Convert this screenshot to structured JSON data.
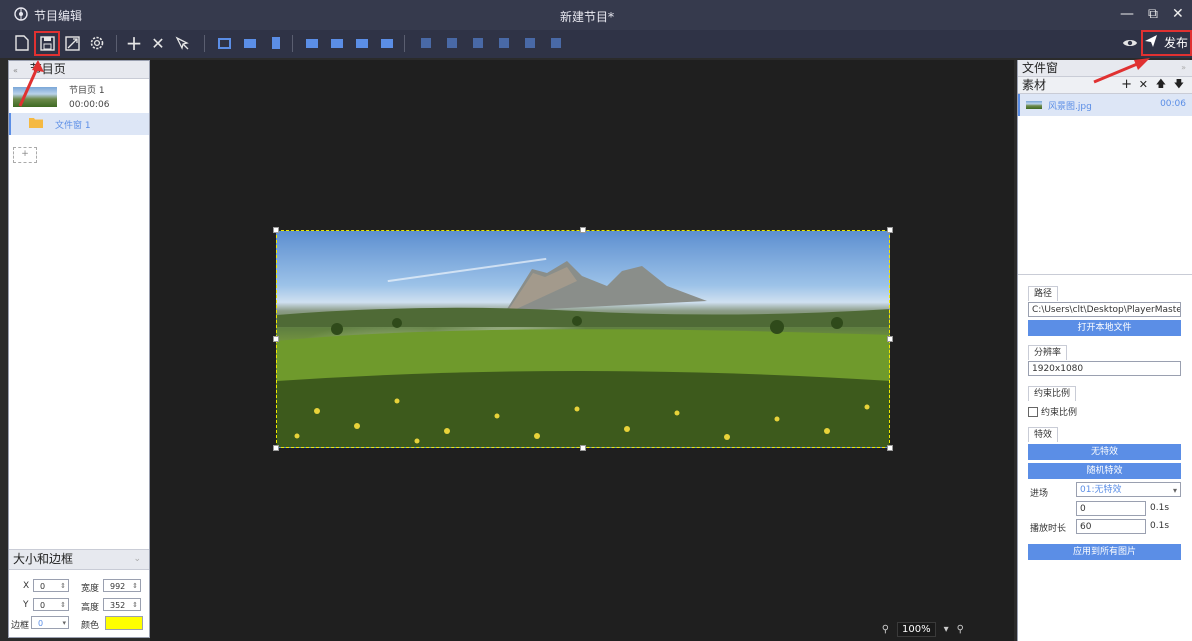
{
  "titlebar": {
    "app_title": "节目编辑",
    "document_title": "新建节目*",
    "restore_icon": "restore-icon",
    "close_icon": "close-icon"
  },
  "toolbar": {
    "publish_label": "发布"
  },
  "left_panel": {
    "header": "节目页",
    "page_item": {
      "name": "节目页 1",
      "duration": "00:00:06"
    },
    "window_item": {
      "name": "文件窗 1"
    },
    "add_symbol": "+",
    "size_panel": {
      "header": "大小和边框",
      "x_label": "X",
      "x_value": "0",
      "width_label": "宽度",
      "width_value": "992",
      "y_label": "Y",
      "y_value": "0",
      "height_label": "高度",
      "height_value": "352",
      "border_label": "边框",
      "border_value": "0",
      "color_label": "颜色",
      "color_value": "#ffff00"
    }
  },
  "canvas": {
    "zoom_value": "100%"
  },
  "right_panel": {
    "header": "文件窗",
    "materials_label": "素材",
    "material_item": {
      "name": "风景图.jpg",
      "duration": "00:06"
    },
    "path_tab": "路径",
    "path_value": "C:\\Users\\clt\\Desktop\\PlayerMaster图片\\J",
    "open_local_file": "打开本地文件",
    "resolution_tab": "分辨率",
    "resolution_value": "1920x1080",
    "constraint_tab": "约束比例",
    "constraint_checkbox": "约束比例",
    "effects_tab": "特效",
    "no_effect": "无特效",
    "random_effect": "随机特效",
    "enter_label": "进场",
    "enter_value": "01:无特效",
    "enter_time": "0",
    "unit_s1": "0.1s",
    "play_duration_label": "播放时长",
    "play_duration_value": "60",
    "unit_s2": "0.1s",
    "apply_all": "应用到所有图片"
  },
  "colors": {
    "accent_blue": "#5b8ee6",
    "highlight_red": "#e03131",
    "titlebar": "#363a4d",
    "canvas_bg": "#1f1f1f",
    "selection_yellow": "#f0e800"
  }
}
